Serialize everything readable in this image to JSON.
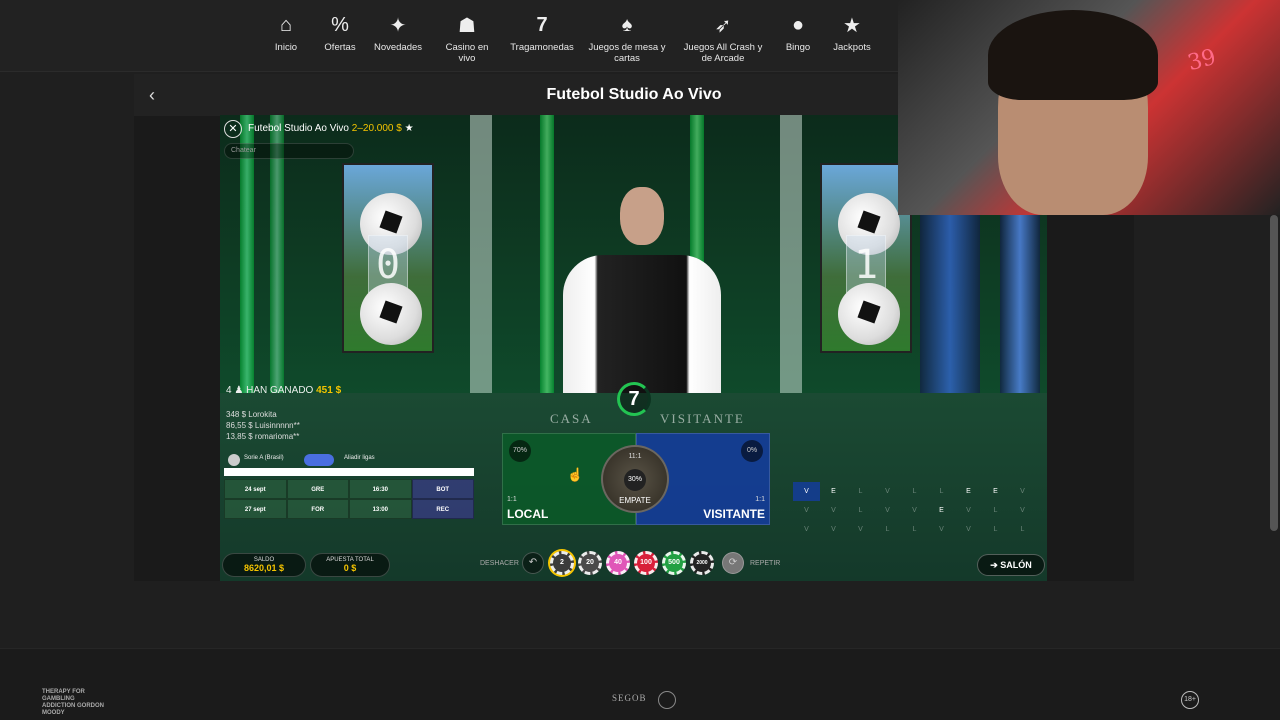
{
  "nav": {
    "items": [
      {
        "label": "Inicio",
        "icon": "house-icon"
      },
      {
        "label": "Ofertas",
        "icon": "percent-badge-icon"
      },
      {
        "label": "Novedades",
        "icon": "sparkles-icon"
      },
      {
        "label": "Casino en vivo",
        "icon": "dealer-icon"
      },
      {
        "label": "Tragamonedas",
        "icon": "seven-slot-icon"
      },
      {
        "label": "Juegos de mesa y cartas",
        "icon": "cards-icon"
      },
      {
        "label": "Juegos All Crash y de Arcade",
        "icon": "rocket-icon"
      },
      {
        "label": "Bingo",
        "icon": "bingo-ball-icon"
      },
      {
        "label": "Jackpots",
        "icon": "star-icon"
      }
    ]
  },
  "panel": {
    "title": "Futebol Studio Ao Vivo"
  },
  "game": {
    "name": "Futebol Studio Ao Vivo",
    "limits": "2–20.000 $",
    "chat_placeholder": "Chatear",
    "score_home": "0",
    "score_away": "1",
    "timer": "7",
    "table_casa": "CASA",
    "table_visitante": "VISITANTE",
    "winners_count": "4",
    "winners_label": "HAN GANADO",
    "winners_amount": "451 $",
    "winners_list": [
      "348 $  Lorokita",
      "86,55 $  Luisinnnnn**",
      "13,85 $  romarioma**"
    ],
    "league_home": "Sorie A (Brasil)",
    "league_away": "Aliadir ligas",
    "fixtures": [
      [
        "24 sept",
        "GRE",
        "16:30",
        "BOT"
      ],
      [
        "27 sept",
        "FOR",
        "13:00",
        "REC"
      ]
    ],
    "local": {
      "label": "LOCAL",
      "pct": "70%",
      "odds": "1:1"
    },
    "visitante": {
      "label": "VISITANTE",
      "pct": "0%",
      "odds": "1:1"
    },
    "empate": {
      "label": "EMPATE",
      "pct": "30%",
      "odds": "11:1"
    },
    "history": [
      [
        "V",
        "E",
        "L",
        "V",
        "L",
        "L",
        "E",
        "E",
        "V"
      ],
      [
        "V",
        "V",
        "L",
        "V",
        "V",
        "E",
        "V",
        "L",
        "V"
      ],
      [
        "V",
        "V",
        "V",
        "L",
        "L",
        "V",
        "V",
        "L",
        "L"
      ]
    ],
    "balance_label": "SALDO",
    "balance_value": "8620,01 $",
    "total_bet_label": "APUESTA TOTAL",
    "total_bet_value": "0 $",
    "undo_label": "DESHACER",
    "repeat_label": "REPETIR",
    "salon_label": "SALÓN",
    "chips": [
      {
        "value": "2",
        "color": "#3b3b3b"
      },
      {
        "value": "20",
        "color": "#4a4a4a"
      },
      {
        "value": "40",
        "color": "#e056b8"
      },
      {
        "value": "100",
        "color": "#d81f3a"
      },
      {
        "value": "500",
        "color": "#22a043"
      },
      {
        "value": "2000",
        "color": "#222222"
      }
    ]
  },
  "webcam": {
    "neon_text": "39"
  },
  "footer": {
    "gordon_text": "THERAPY FOR GAMBLING ADDICTION GORDON MOODY",
    "segob": "SEGOB",
    "age": "18+"
  }
}
